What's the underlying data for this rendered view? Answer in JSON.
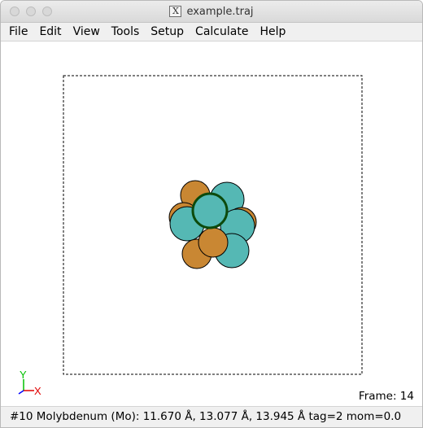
{
  "window": {
    "title": "example.traj"
  },
  "menu": [
    {
      "id": "file",
      "label": "File"
    },
    {
      "id": "edit",
      "label": "Edit"
    },
    {
      "id": "view",
      "label": "View"
    },
    {
      "id": "tools",
      "label": "Tools"
    },
    {
      "id": "setup",
      "label": "Setup"
    },
    {
      "id": "calculate",
      "label": "Calculate"
    },
    {
      "id": "help",
      "label": "Help"
    }
  ],
  "axes": {
    "y_label": "Y",
    "x_label": "X",
    "y_color": "#00c000",
    "x_color": "#e00000",
    "z_color": "#0000ff"
  },
  "atom_colors": {
    "copper": "#c98733",
    "teal": "#55b8b4",
    "selected_outline": "#0c4a0c"
  },
  "frame_text": "Frame: 14",
  "status_text": "#10 Molybdenum (Mo): 11.670 Å, 13.077 Å, 13.945 Å  tag=2 mom=0.0"
}
